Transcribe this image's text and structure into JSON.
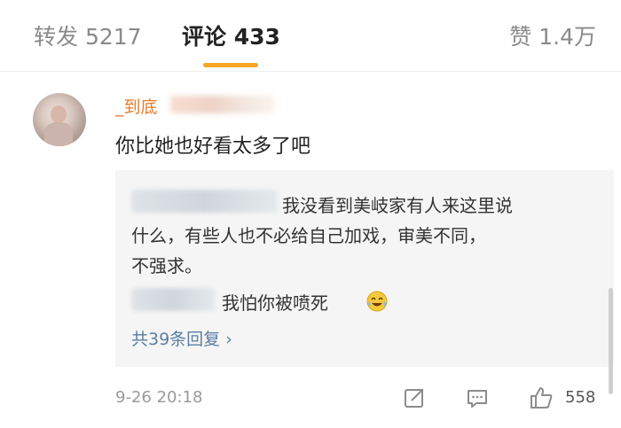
{
  "tabs": [
    {
      "label": "转发 5217"
    },
    {
      "label": "评论 433"
    },
    {
      "label": "赞 1.4万"
    }
  ],
  "active_tab_color": "#f5a623",
  "comment": {
    "username_visible": "_到底",
    "text": "你比她也好看太多了吧",
    "timestamp": "9-26 20:18",
    "like_count": "558",
    "username_color": "#e77b2a"
  },
  "replies": {
    "first_reply_lines": [
      "我没看到美岐家有人来这里说",
      "什么，有些人也不必给自己加戏，审美不同，",
      "不强求。"
    ],
    "second_reply": "我怕你被喷死",
    "view_more_label": "共39条回复 ›",
    "link_color": "#5b7ea3"
  },
  "icons": {
    "share": "share-icon",
    "reply": "comment-icon",
    "like": "thumbs-up-icon",
    "laugh": "laughing-face-icon"
  }
}
